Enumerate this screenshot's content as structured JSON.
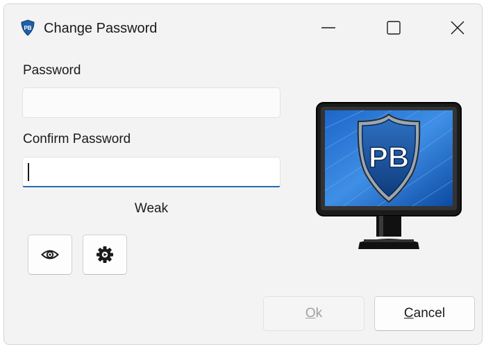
{
  "window": {
    "title": "Change Password",
    "app_icon_text": "PB"
  },
  "titlebar": {
    "minimize_icon": "minimize-icon",
    "maximize_icon": "maximize-icon",
    "close_icon": "close-icon"
  },
  "form": {
    "password_label": "Password",
    "password_value": "",
    "confirm_label": "Confirm Password",
    "confirm_value": "",
    "strength_text": "Weak"
  },
  "tools": {
    "show_password_icon": "eye-icon",
    "settings_icon": "gear-icon"
  },
  "logo": {
    "text": "PB"
  },
  "buttons": {
    "ok_mnemonic": "O",
    "ok_rest": "k",
    "cancel_mnemonic": "C",
    "cancel_rest": "ancel"
  },
  "colors": {
    "accent": "#2568b4",
    "window_bg": "#f3f3f3",
    "disabled_text": "#a0a0a0"
  }
}
